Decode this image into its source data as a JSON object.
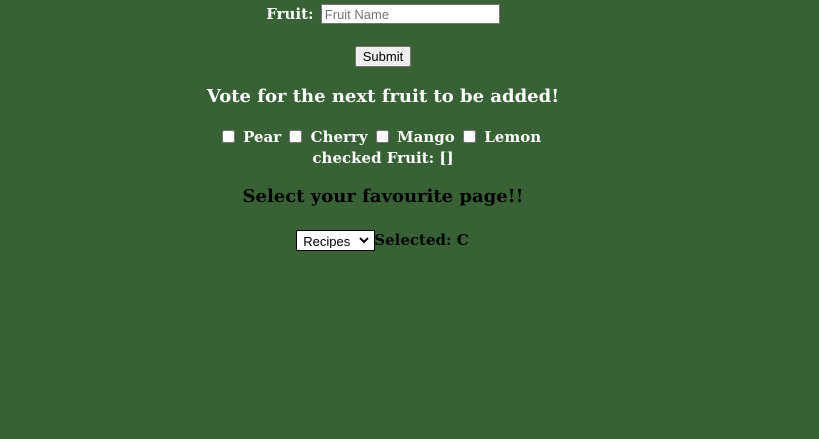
{
  "form": {
    "fruit_label": "Fruit:",
    "fruit_placeholder": "Fruit Name",
    "submit_label": "Submit"
  },
  "vote": {
    "heading": "Vote for the next fruit to be added!",
    "options": [
      "Pear",
      "Cherry",
      "Mango",
      "Lemon"
    ],
    "checked_text": "checked Fruit: []"
  },
  "favourite": {
    "heading": "Select your favourite page!!",
    "selected_option": "Recipes",
    "selected_text": "Selected: C"
  },
  "colors": {
    "background": "#386135",
    "primary_text": "#ffffff",
    "secondary_text": "#000000"
  }
}
